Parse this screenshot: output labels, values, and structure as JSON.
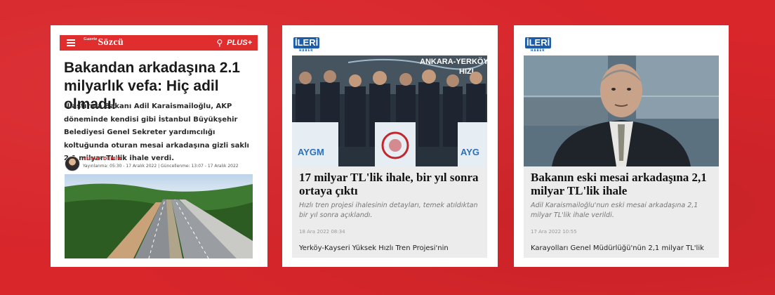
{
  "card1": {
    "site": "Sözcü",
    "site_small": "Gazete",
    "plus": "PLUS+",
    "title": "Bakandan arkadaşına 2.1 milyarlık vefa: Hiç adil olmadı!",
    "lead": "Ulaştırma Bakanı Adil Karaismailoğlu, AKP döneminde kendisi gibi İstanbul Büyükşehir Belediyesi Genel Sekreter yardımcılığı koltuğunda oturan mesai arkadaşına gizli saklı 2.1 milyar TL'lik ihale verdi.",
    "author": "YUSUF DEMİR",
    "meta": "Yayınlanma: 05:30 - 17 Aralık 2022  |  Güncellenme: 13:07 - 17 Aralık 2022"
  },
  "card2": {
    "logo": "İLERİ",
    "logo_sub": "HABER",
    "photo_text_1": "ANKARA-YERKÖY",
    "photo_text_2": "HIZL",
    "podium_1": "AYGM",
    "podium_3": "AYG",
    "title": "17 milyar TL'lik ihale, bir yıl sonra ortaya çıktı",
    "desc": "Hızlı tren projesi ihalesinin detayları, temek atıldıktan bir yıl sonra açıklandı.",
    "date": "18 Ara 2022 08:34",
    "more": "Yerköy-Kayseri Yüksek Hızlı Tren Projesi'nin"
  },
  "card3": {
    "logo": "İLERİ",
    "logo_sub": "HABER",
    "title": "Bakanın eski mesai arkadaşına 2,1 milyar TL'lik ihale",
    "desc": "Adil Karaismailoğlu'nun eski mesai arkadaşına 2,1 milyar TL'lik ihale verildi.",
    "date": "17 Ara 2022 10:55",
    "more": "Karayolları Genel Müdürlüğü'nün 2,1 milyar TL'lik"
  },
  "colors": {
    "background": "#d8262b",
    "sozcu_red": "#e02d2d",
    "ileri_blue": "#1b5dab"
  }
}
